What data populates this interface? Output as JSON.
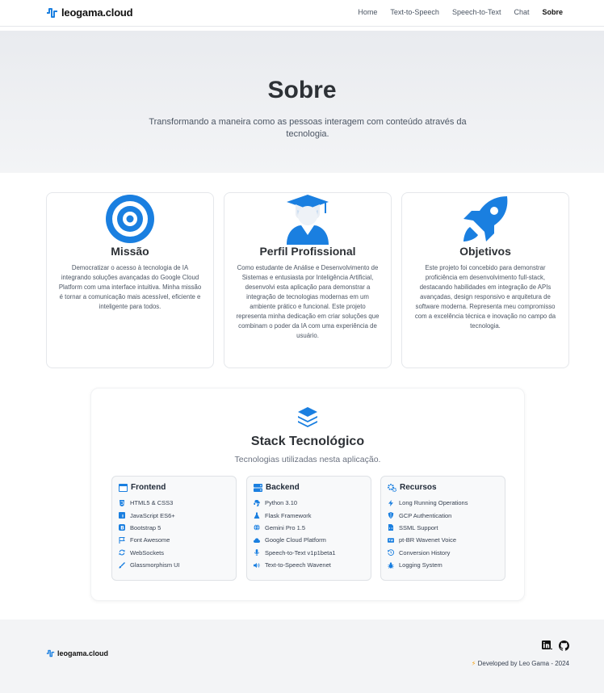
{
  "navbar": {
    "brand": "leogama.cloud",
    "links": [
      "Home",
      "Text-to-Speech",
      "Speech-to-Text",
      "Chat",
      "Sobre"
    ],
    "active": "Sobre"
  },
  "hero": {
    "title": "Sobre",
    "subtitle": "Transformando a maneira como as pessoas interagem com conteúdo através da tecnologia."
  },
  "cards": [
    {
      "icon": "target-icon",
      "title": "Missão",
      "text": "Democratizar o acesso à tecnologia de IA integrando soluções avançadas do Google Cloud Platform com uma interface intuitiva. Minha missão é tornar a comunicação mais acessível, eficiente e inteligente para todos."
    },
    {
      "icon": "graduate-icon",
      "title": "Perfil Profissional",
      "text": "Como estudante de Análise e Desenvolvimento de Sistemas e entusiasta por Inteligência Artificial, desenvolvi esta aplicação para demonstrar a integração de tecnologias modernas em um ambiente prático e funcional. Este projeto representa minha dedicação em criar soluções que combinam o poder da IA com uma experiência de usuário."
    },
    {
      "icon": "rocket-icon",
      "title": "Objetivos",
      "text": "Este projeto foi concebido para demonstrar proficiência em desenvolvimento full-stack, destacando habilidades em integração de APIs avançadas, design responsivo e arquitetura de software moderna. Representa meu compromisso com a excelência técnica e inovação no campo da tecnologia."
    }
  ],
  "stack": {
    "icon": "layers-icon",
    "title": "Stack Tecnológico",
    "subtitle": "Tecnologias utilizadas nesta aplicação.",
    "columns": [
      {
        "title": "Frontend",
        "items": [
          "HTML5 & CSS3",
          "JavaScript ES6+",
          "Bootstrap 5",
          "Font Awesome",
          "WebSockets",
          "Glassmorphism UI"
        ]
      },
      {
        "title": "Backend",
        "items": [
          "Python 3.10",
          "Flask Framework",
          "Gemini Pro 1.5",
          "Google Cloud Platform",
          "Speech-to-Text v1p1beta1",
          "Text-to-Speech Wavenet"
        ]
      },
      {
        "title": "Recursos",
        "items": [
          "Long Running Operations",
          "GCP Authentication",
          "SSML Support",
          "pt-BR Wavenet Voice",
          "Conversion History",
          "Logging System"
        ]
      }
    ]
  },
  "footer": {
    "brand": "leogama.cloud",
    "credit": "Developed by Leo Gama - 2024",
    "social": [
      "linkedin-icon",
      "github-icon"
    ]
  },
  "colors": {
    "accent": "#1a7fe0",
    "text": "#2d3136",
    "hero_bg": "#eceef1"
  }
}
